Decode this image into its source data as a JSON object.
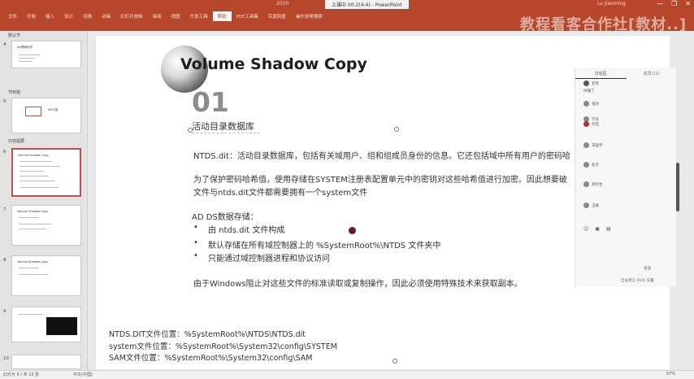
{
  "window": {
    "title_left": "2020",
    "title_center": "上课中 00:2(4:4)",
    "title_after": "- PowerPoint",
    "user": "Lu Jianming",
    "watermark": "教程看客合作社[教材..]"
  },
  "ribbon_tabs": [
    "文件",
    "开始",
    "插入",
    "设计",
    "切换",
    "动画",
    "幻灯片放映",
    "审阅",
    "视图",
    "开发工具",
    "帮助",
    "PDF工具集",
    "百度网盘",
    "操作说明搜索"
  ],
  "active_tab_index": 10,
  "thumbnails": {
    "sections": [
      {
        "label": "默认节"
      },
      {
        "label": "节标题"
      },
      {
        "label": "内容提要"
      }
    ],
    "slides": [
      {
        "num": "4",
        "title": "AD基础知识"
      },
      {
        "num": "5",
        "title": "AD介绍"
      },
      {
        "num": "6",
        "title": "Volume Shadow Copy"
      },
      {
        "num": "7",
        "title": "Volume Shadow Copy"
      },
      {
        "num": "8",
        "title": "Volume Shadow Copy"
      },
      {
        "num": "9",
        "title": ""
      },
      {
        "num": "10",
        "title": ""
      }
    ]
  },
  "slide": {
    "title": "Volume Shadow Copy",
    "number": "01",
    "subtitle": "活动目录数据库",
    "line1": "NTDS.dit：活动目录数据库，包括有关域用户、组和组成员身份的信息。它还包括域中所有用户的密码哈",
    "line2": "为了保护密码哈希值，使用存储在SYSTEM注册表配置单元中的密钥对这些哈希值进行加密。因此想要破",
    "line3": "文件与ntds.dit文件都需要拥有一个system文件",
    "line4": "AD DS数据存储：",
    "bullets": [
      "由 ntds.dit 文件构成",
      "默认存储在所有域控制器上的 %SystemRoot%\\NTDS 文件夹中",
      "只能通过域控制器进程和协议访问"
    ],
    "line5": "由于Windows阻止对这些文件的标准读取或复制操作，因此必须使用特殊技术来获取副本。",
    "path1": "NTDS.DIT文件位置：%SystemRoot%\\NTDS\\NTDS.dit",
    "path2": "system文件位置：%SystemRoot%\\System32\\config\\SYSTEM",
    "path3": "SAM文件位置：%SystemRoot%\\System32\\config\\SAM"
  },
  "chat": {
    "tabs": [
      "讨论区",
      "成员(12)"
    ],
    "messages": [
      {
        "name": "老师",
        "text": "听懂了"
      },
      {
        "name": "张同"
      },
      {
        "name": "学员"
      },
      {
        "name": "刘佳"
      },
      {
        "name": "李国宇"
      },
      {
        "name": "赵子"
      },
      {
        "name": "旁听生"
      },
      {
        "name": "王群"
      }
    ],
    "footer1": "发送",
    "footer2": "全员禁言 (0/4) 设置"
  },
  "status": {
    "slide_info": "幻灯片 6 / 共 15 张",
    "lang": "中文(中国)",
    "zoom": "57%"
  }
}
